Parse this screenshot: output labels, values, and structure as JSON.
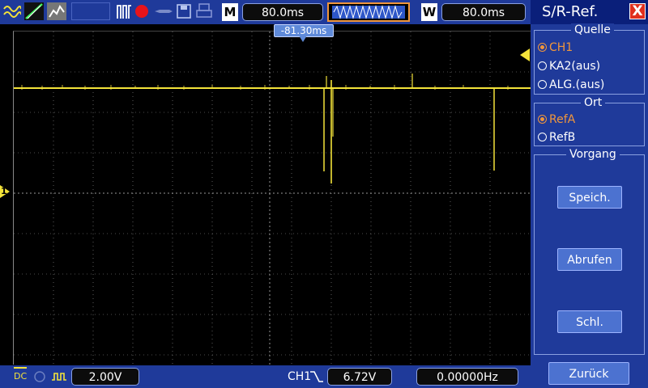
{
  "toolbar": {
    "m_label": "M",
    "time_base": "80.0ms",
    "w_label": "W",
    "window_time": "80.0ms"
  },
  "screen": {
    "position_marker": "-81.30ms",
    "channel_marker": "1"
  },
  "status": {
    "coupling": "DC",
    "volts_div": "2.00V",
    "trigger_channel": "CH1",
    "trigger_level": "6.72V",
    "frequency": "0.00000Hz"
  },
  "panel": {
    "title": "S/R-Ref.",
    "close": "X",
    "source_group": "Quelle",
    "sources": [
      "CH1",
      "KA2(aus)",
      "ALG.(aus)"
    ],
    "location_group": "Ort",
    "locations": [
      "RefA",
      "RefB"
    ],
    "operation_group": "Vorgang",
    "save": "Speich.",
    "recall": "Abrufen",
    "close_op": "Schl.",
    "back": "Zurück"
  },
  "colors": {
    "trace": "#f4e33a",
    "bar": "#1f3a9a",
    "accent": "#f0963c"
  }
}
